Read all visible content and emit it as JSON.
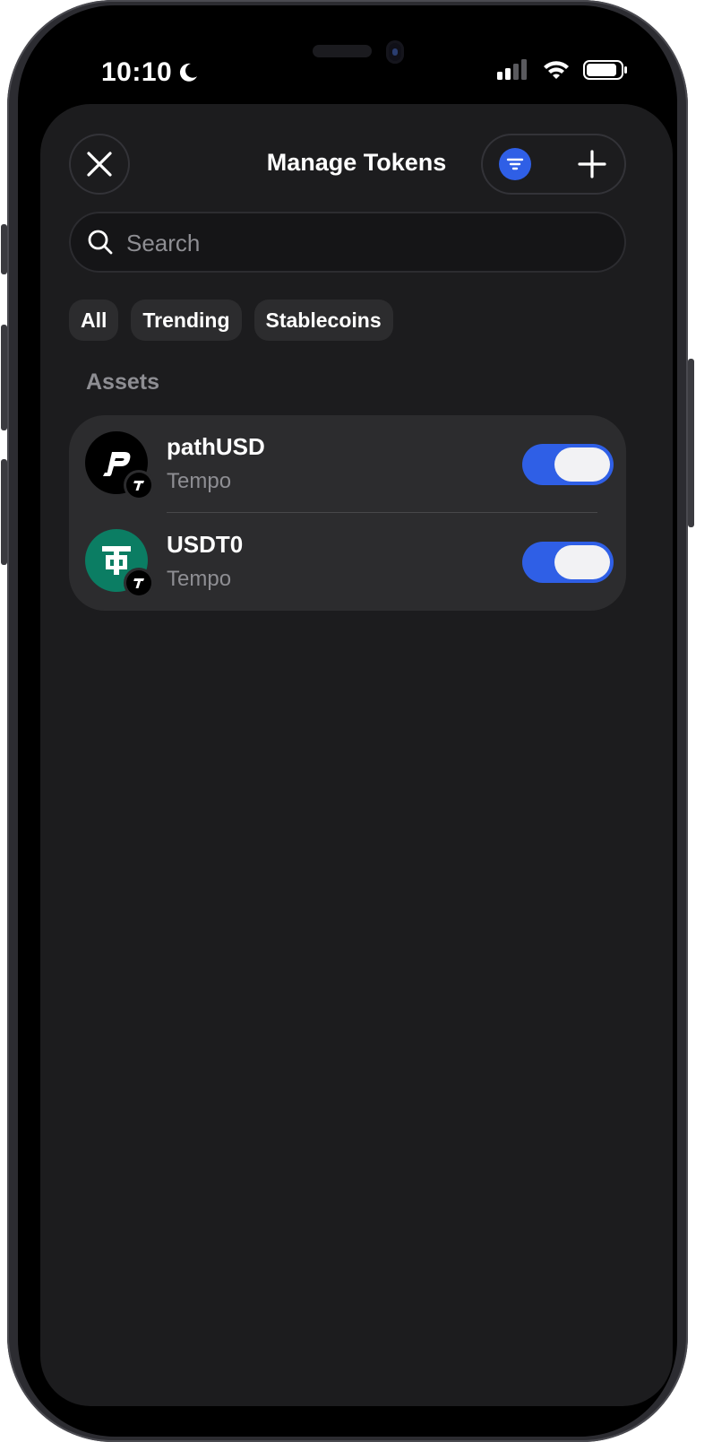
{
  "status_bar": {
    "time": "10:10",
    "icons": [
      "moon-icon",
      "signal-icon",
      "wifi-icon",
      "battery-icon"
    ]
  },
  "header": {
    "title": "Manage Tokens",
    "close_icon": "close-icon",
    "filter_icon": "filter-icon",
    "add_icon": "plus-icon"
  },
  "search": {
    "placeholder": "Search",
    "value": ""
  },
  "filters": [
    {
      "label": "All"
    },
    {
      "label": "Trending"
    },
    {
      "label": "Stablecoins"
    }
  ],
  "assets": {
    "section_label": "Assets",
    "items": [
      {
        "name": "pathUSD",
        "chain": "Tempo",
        "enabled": true,
        "icon_color": "#000000"
      },
      {
        "name": "USDT0",
        "chain": "Tempo",
        "enabled": true,
        "icon_color": "#0b7d63"
      }
    ]
  },
  "colors": {
    "accent": "#2f5fe6",
    "sheet_bg": "#1c1c1e",
    "card_bg": "#2c2c2e",
    "secondary_text": "#8e8e93"
  }
}
